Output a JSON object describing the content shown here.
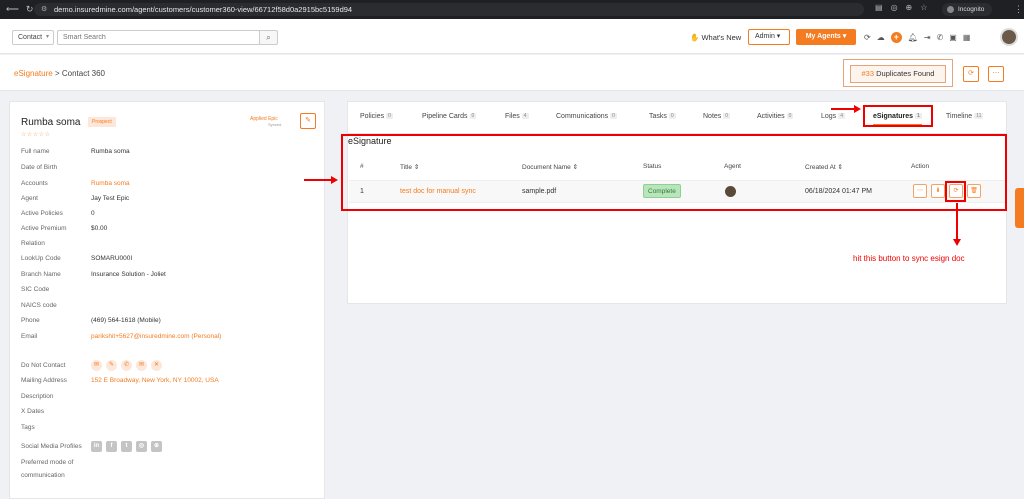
{
  "browser": {
    "url": "demo.insuredmine.com/agent/customers/customer360-view/66712f58d0a2915bc5159d94",
    "incognito_label": "Incognito"
  },
  "header": {
    "contact_select": "Contact",
    "search_placeholder": "Smart Search",
    "whats_new": "What's New",
    "admin_select": "Admin",
    "agents_button": "My Agents"
  },
  "breadcrumb": {
    "root": "eSignature",
    "separator": ">",
    "current": "Contact 360"
  },
  "duplicates": {
    "count": "#33",
    "label": "Duplicates Found"
  },
  "profile": {
    "name": "Rumba soma",
    "badge": "Prospect",
    "stars": "☆☆☆☆☆",
    "applied_label": "Applied Epic",
    "applied_sub": "Synced",
    "fields": [
      {
        "label": "Full name",
        "value": "Rumba soma",
        "orange": false
      },
      {
        "label": "Date of Birth",
        "value": "",
        "orange": false
      },
      {
        "label": "Accounts",
        "value": "Rumba soma",
        "orange": true
      },
      {
        "label": "Agent",
        "value": "Jay Test Epic",
        "orange": false
      },
      {
        "label": "Active Policies",
        "value": "0",
        "orange": false
      },
      {
        "label": "Active Premium",
        "value": "$0.00",
        "orange": false
      },
      {
        "label": "Relation",
        "value": "",
        "orange": false
      },
      {
        "label": "LookUp Code",
        "value": "SOMARU000I",
        "orange": false
      },
      {
        "label": "Branch Name",
        "value": "Insurance Solution - Joliet",
        "orange": false
      },
      {
        "label": "SIC Code",
        "value": "",
        "orange": false
      },
      {
        "label": "NAICS code",
        "value": "",
        "orange": false
      },
      {
        "label": "Phone",
        "value": "(469) 564-1618 (Mobile)",
        "orange": false
      },
      {
        "label": "Email",
        "value": "parikshit+5627@insuredmine.com  (Personal)",
        "orange": true
      },
      {
        "label": "Do Not Contact",
        "value": "",
        "orange": false
      },
      {
        "label": "Mailing Address",
        "value": "152 E Broadway, New York, NY 10002, USA",
        "orange": true
      },
      {
        "label": "Description",
        "value": "",
        "orange": false
      },
      {
        "label": "X Dates",
        "value": "",
        "orange": false
      },
      {
        "label": "Tags",
        "value": "",
        "orange": false
      },
      {
        "label": "Social Media Profiles",
        "value": "",
        "orange": false
      },
      {
        "label": "Preferred mode of",
        "value": "",
        "orange": false
      },
      {
        "label": "communication",
        "value": "",
        "orange": false
      }
    ]
  },
  "tabs": [
    {
      "label": "Policies",
      "count": "0"
    },
    {
      "label": "Pipeline Cards",
      "count": "0"
    },
    {
      "label": "Files",
      "count": "4"
    },
    {
      "label": "Communications",
      "count": "0"
    },
    {
      "label": "Tasks",
      "count": "0"
    },
    {
      "label": "Notes",
      "count": "0"
    },
    {
      "label": "Activities",
      "count": "0"
    },
    {
      "label": "Logs",
      "count": "4"
    },
    {
      "label": "eSignatures",
      "count": "1"
    },
    {
      "label": "Timeline",
      "count": "11"
    }
  ],
  "esignature": {
    "title": "eSignature",
    "columns": [
      "#",
      "Title ⇕",
      "Document Name ⇕",
      "Status",
      "Agent",
      "Created At ⇕",
      "Action"
    ],
    "row": {
      "num": "1",
      "title": "test doc for manual sync",
      "document": "sample.pdf",
      "status": "Complete",
      "created_at": "06/18/2024 01:47 PM"
    }
  },
  "annotation": {
    "text": "hit this button to sync esign doc",
    "color": "#e00000"
  },
  "colors": {
    "accent": "#f47b20",
    "status_complete_bg": "#b9e5bd"
  }
}
